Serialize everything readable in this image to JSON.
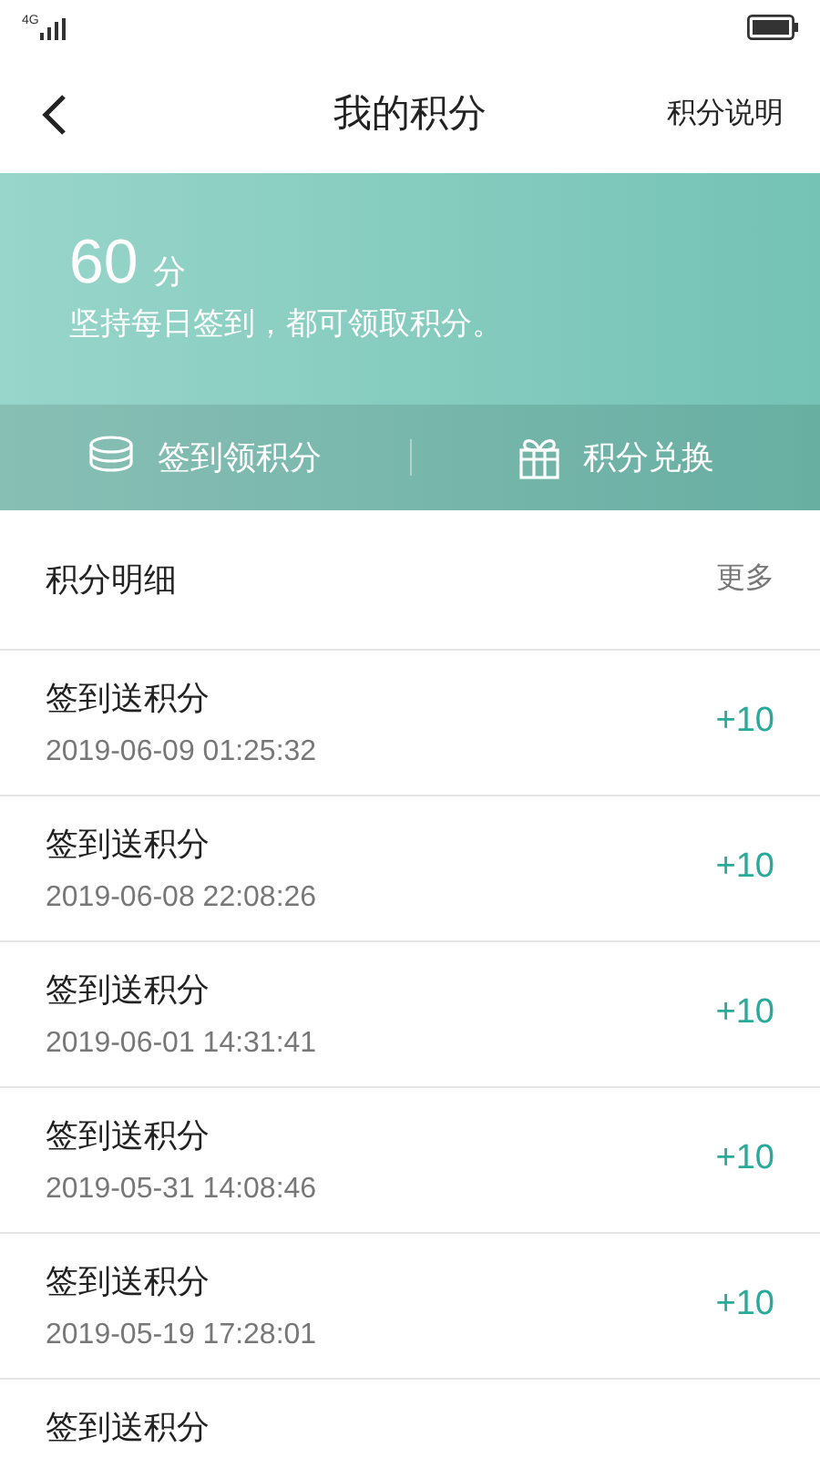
{
  "status_bar": {
    "network": "4G"
  },
  "header": {
    "title": "我的积分",
    "action": "积分说明"
  },
  "summary": {
    "points": "60",
    "unit": "分",
    "hint": "坚持每日签到，都可领取积分。"
  },
  "actions": [
    {
      "kind": "coins",
      "label": "签到领积分"
    },
    {
      "kind": "gift",
      "label": "积分兑换"
    }
  ],
  "section": {
    "title": "积分明细",
    "more": "更多"
  },
  "records": [
    {
      "title": "签到送积分",
      "time": "2019-06-09 01:25:32",
      "amount": "+10"
    },
    {
      "title": "签到送积分",
      "time": "2019-06-08 22:08:26",
      "amount": "+10"
    },
    {
      "title": "签到送积分",
      "time": "2019-06-01 14:31:41",
      "amount": "+10"
    },
    {
      "title": "签到送积分",
      "time": "2019-05-31 14:08:46",
      "amount": "+10"
    },
    {
      "title": "签到送积分",
      "time": "2019-05-19 17:28:01",
      "amount": "+10"
    },
    {
      "title": "签到送积分"
    }
  ]
}
